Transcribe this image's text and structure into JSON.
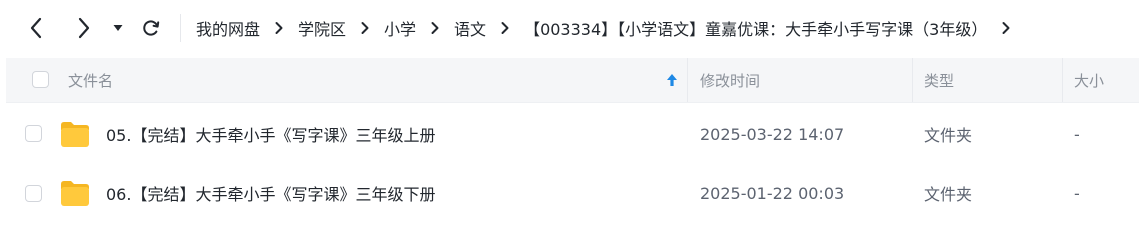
{
  "toolbar": {
    "back_icon": "chevron-left-icon",
    "forward_icon": "chevron-right-icon",
    "dropdown_icon": "caret-down-icon",
    "refresh_icon": "refresh-icon"
  },
  "breadcrumb": [
    {
      "label": "我的网盘"
    },
    {
      "label": "学院区"
    },
    {
      "label": "小学"
    },
    {
      "label": "语文"
    },
    {
      "label": "【003334】【小学语文】童嘉优课：大手牵小手写字课（3年级）"
    }
  ],
  "table": {
    "columns": {
      "name": "文件名",
      "modified": "修改时间",
      "type": "类型",
      "size": "大小"
    },
    "sort_icon": "sort-up-arrow-icon",
    "rows": [
      {
        "name": "05.【完结】大手牵小手《写字课》三年级上册",
        "modified": "2025-03-22 14:07",
        "type": "文件夹",
        "size": "-",
        "icon": "folder-icon"
      },
      {
        "name": "06.【完结】大手牵小手《写字课》三年级下册",
        "modified": "2025-01-22 00:03",
        "type": "文件夹",
        "size": "-",
        "icon": "folder-icon"
      }
    ]
  },
  "colors": {
    "accent": "#1e88e5",
    "folder": "#ffc93c",
    "text": "#22272e",
    "muted": "#8a9099"
  }
}
